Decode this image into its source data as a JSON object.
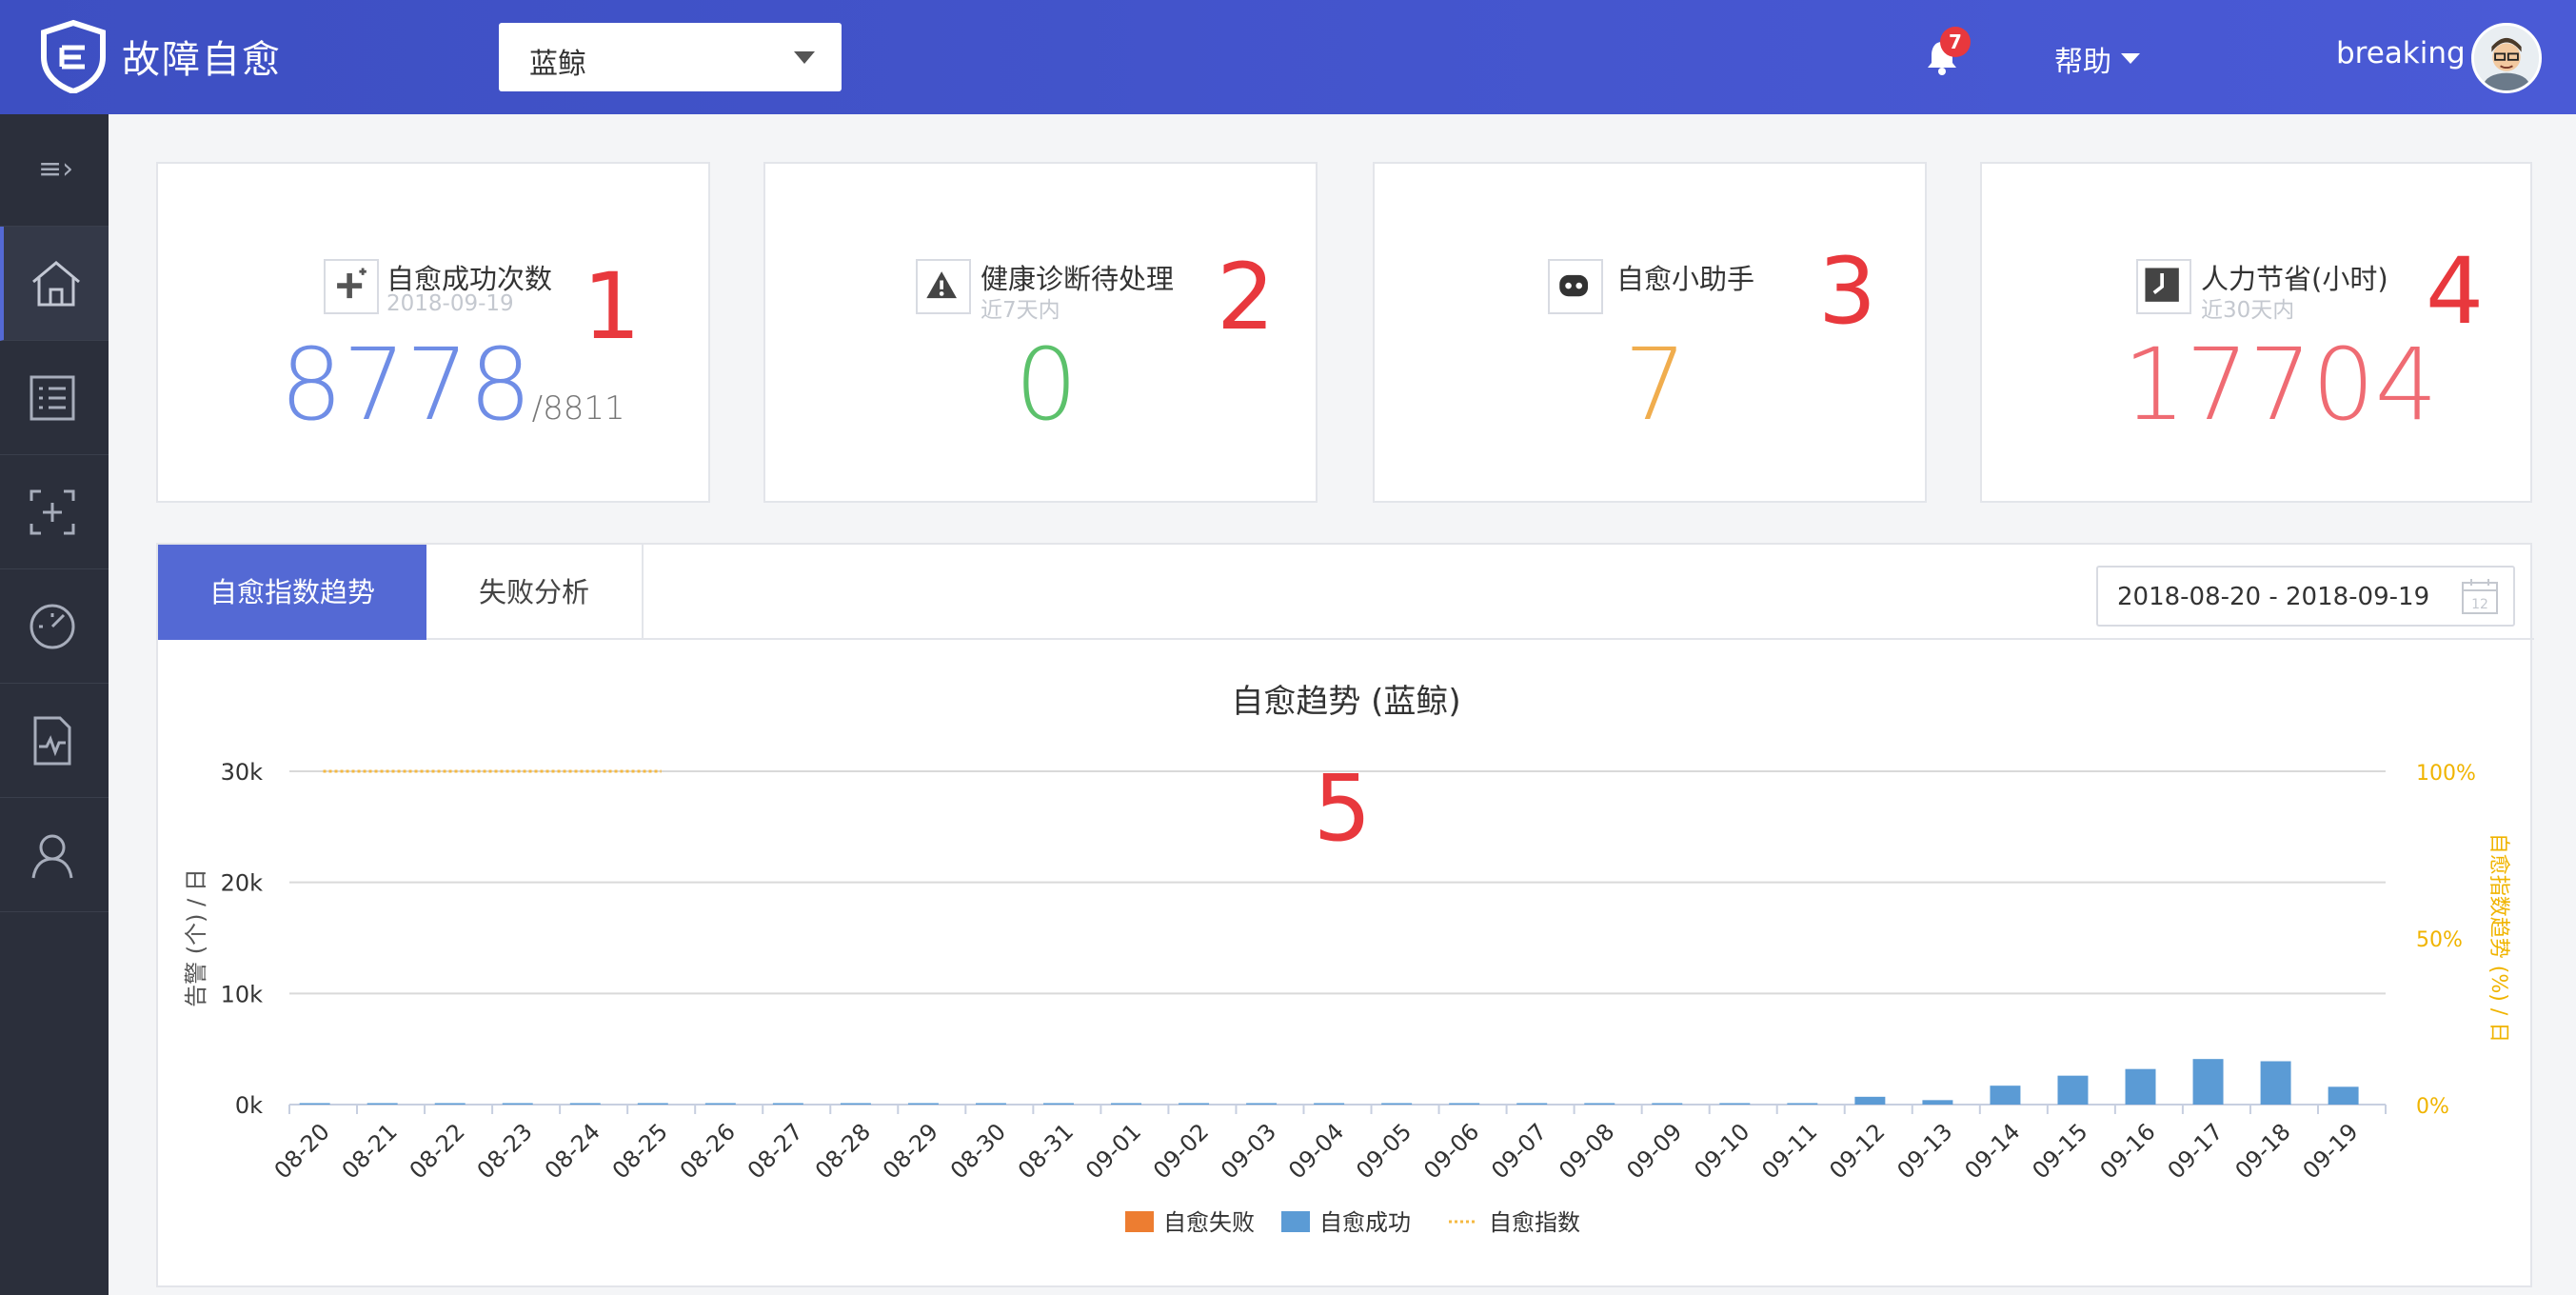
{
  "header": {
    "app_title": "故障自愈",
    "project_select": "蓝鲸",
    "notification_count": "7",
    "help_label": "帮助",
    "username": "breaking",
    "brand_color": "#4352cc"
  },
  "sidebar": {
    "items": [
      {
        "icon": "home-icon",
        "active": true
      },
      {
        "icon": "list-icon"
      },
      {
        "icon": "add-frame-icon"
      },
      {
        "icon": "gauge-icon"
      },
      {
        "icon": "chart-file-icon"
      },
      {
        "icon": "user-icon"
      }
    ]
  },
  "cards": [
    {
      "title": "自愈成功次数",
      "sub": "2018-09-19",
      "value": "8778",
      "total": "/8811",
      "mark": "1",
      "color": "#6f8de6",
      "icon": "plus-icon"
    },
    {
      "title": "健康诊断待处理",
      "sub": "近7天内",
      "value": "0",
      "mark": "2",
      "color": "#5cc16b",
      "icon": "warning-icon"
    },
    {
      "title": "自愈小助手",
      "sub": "",
      "value": "7",
      "mark": "3",
      "color": "#f0ad4e",
      "icon": "robot-icon"
    },
    {
      "title": "人力节省(小时)",
      "sub": "近30天内",
      "value": "17704",
      "mark": "4",
      "color": "#ef6b73",
      "icon": "clock-icon"
    }
  ],
  "tabs": {
    "active": "自愈指数趋势",
    "second": "失败分析"
  },
  "date_range": "2018-08-20 - 2018-09-19",
  "calendar_day": "12",
  "chart_mark": "5",
  "chart_data": {
    "type": "bar",
    "title": "自愈趋势 (蓝鲸)",
    "ylabel": "告警 (个) / 日",
    "y2label": "自愈指数趋势 (%) / 日",
    "ylim": [
      0,
      30000
    ],
    "y_ticks": [
      "0k",
      "10k",
      "20k",
      "30k"
    ],
    "y2_ticks": [
      "0%",
      "50%",
      "100%"
    ],
    "categories": [
      "08-20",
      "08-21",
      "08-22",
      "08-23",
      "08-24",
      "08-25",
      "08-26",
      "08-27",
      "08-28",
      "08-29",
      "08-30",
      "08-31",
      "09-01",
      "09-02",
      "09-03",
      "09-04",
      "09-05",
      "09-06",
      "09-07",
      "09-08",
      "09-09",
      "09-10",
      "09-11",
      "09-12",
      "09-13",
      "09-14",
      "09-15",
      "09-16",
      "09-17",
      "09-18",
      "09-19"
    ],
    "series": [
      {
        "name": "自愈失败",
        "color": "#ed7d31",
        "values": [
          0,
          0,
          0,
          0,
          0,
          0,
          0,
          0,
          0,
          0,
          0,
          0,
          0,
          0,
          0,
          0,
          0,
          0,
          0,
          0,
          0,
          0,
          0,
          0,
          0,
          0,
          0,
          0,
          0,
          0,
          0
        ]
      },
      {
        "name": "自愈成功",
        "color": "#5b9bd5",
        "values": [
          0,
          0,
          0,
          0,
          0,
          0,
          0,
          0,
          0,
          0,
          0,
          0,
          0,
          0,
          0,
          0,
          0,
          0,
          0,
          0,
          0,
          0,
          0,
          700,
          400,
          1700,
          2600,
          3200,
          4100,
          3900,
          1600
        ]
      },
      {
        "name": "自愈指数",
        "color": "#f5b942",
        "line_values": [
          100,
          100,
          100,
          100,
          100,
          100
        ]
      }
    ]
  }
}
